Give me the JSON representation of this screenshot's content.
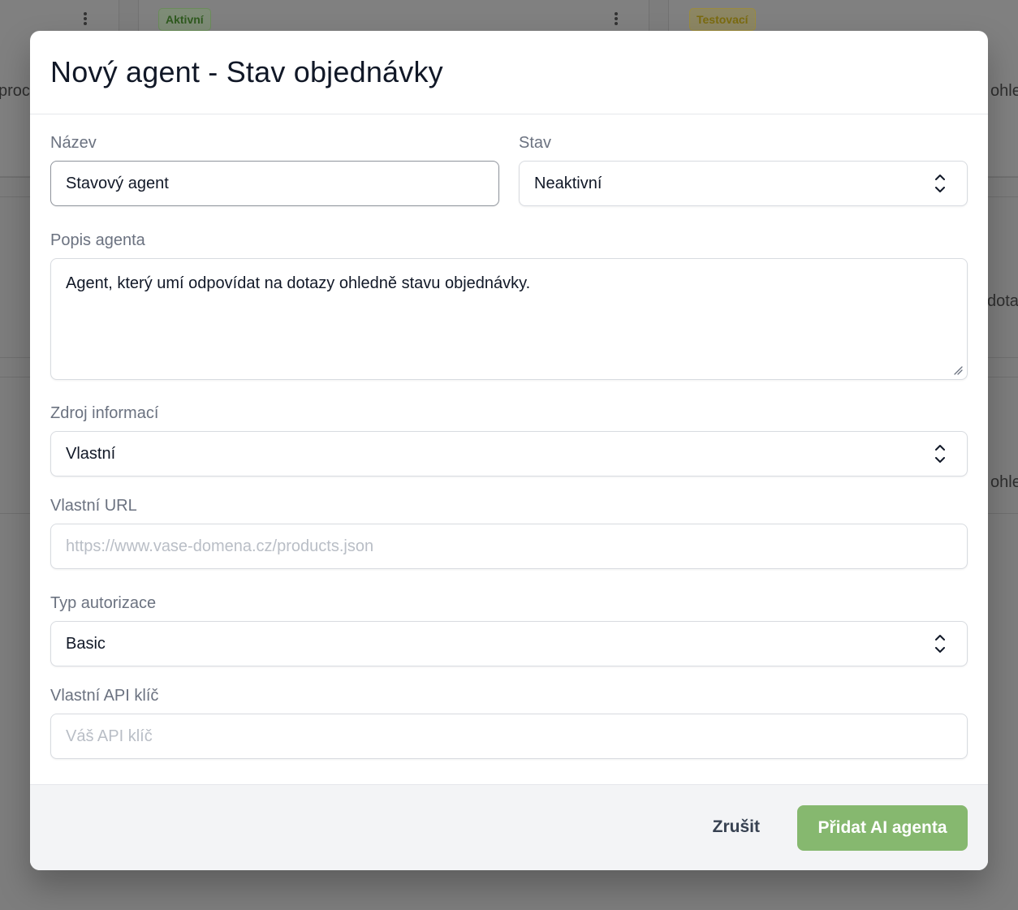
{
  "background": {
    "badges": {
      "active": "Aktivní",
      "testing": "Testovací"
    },
    "fragments": {
      "left_top": "proc",
      "right_top": "ohle",
      "right_mid": "dota",
      "right_bottom": "ohle"
    }
  },
  "modal": {
    "title": "Nový agent - Stav objednávky",
    "fields": {
      "name": {
        "label": "Název",
        "value": "Stavový agent"
      },
      "status": {
        "label": "Stav",
        "value": "Neaktivní"
      },
      "description": {
        "label": "Popis agenta",
        "value": "Agent, který umí odpovídat na dotazy ohledně stavu objednávky."
      },
      "source": {
        "label": "Zdroj informací",
        "value": "Vlastní"
      },
      "custom_url": {
        "label": "Vlastní URL",
        "placeholder": "https://www.vase-domena.cz/products.json",
        "value": ""
      },
      "auth_type": {
        "label": "Typ autorizace",
        "value": "Basic"
      },
      "api_key": {
        "label": "Vlastní API klíč",
        "placeholder": "Váš API klíč",
        "value": ""
      }
    },
    "footer": {
      "cancel_label": "Zrušit",
      "submit_label": "Přidat AI agenta"
    }
  },
  "colors": {
    "primary_button": "#86b86f",
    "footer_bg": "#f3f4f6",
    "overlay": "#7c7c7c"
  }
}
